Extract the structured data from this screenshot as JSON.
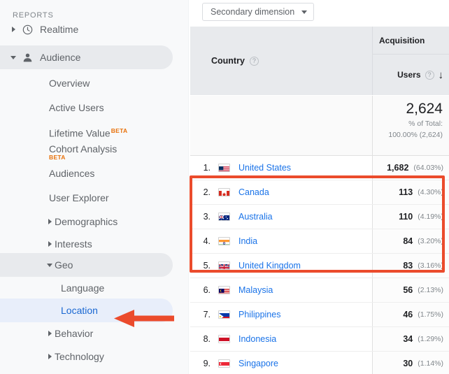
{
  "sidebar": {
    "section_label": "REPORTS",
    "items": [
      {
        "label": "Realtime",
        "level": 1,
        "caret": "right",
        "icon": "clock-icon",
        "state": "default"
      },
      {
        "label": "Audience",
        "level": 1,
        "caret": "down",
        "icon": "person-icon",
        "state": "selected-gray"
      },
      {
        "label": "Overview",
        "level": 2,
        "caret": "none",
        "state": "default"
      },
      {
        "label": "Active Users",
        "level": 2,
        "caret": "none",
        "state": "default"
      },
      {
        "label": "Lifetime Value",
        "level": 2,
        "caret": "none",
        "badge": "BETA",
        "badge_pos": "sup",
        "state": "default"
      },
      {
        "label": "Cohort Analysis",
        "level": 2,
        "caret": "none",
        "badge": "BETA",
        "badge_pos": "below",
        "state": "default"
      },
      {
        "label": "Audiences",
        "level": 2,
        "caret": "none",
        "state": "default"
      },
      {
        "label": "User Explorer",
        "level": 2,
        "caret": "none",
        "state": "default"
      },
      {
        "label": "Demographics",
        "level": 2,
        "caret": "right",
        "state": "default"
      },
      {
        "label": "Interests",
        "level": 2,
        "caret": "right",
        "state": "default"
      },
      {
        "label": "Geo",
        "level": 2,
        "caret": "down",
        "state": "selected-gray"
      },
      {
        "label": "Language",
        "level": 3,
        "caret": "none",
        "state": "default"
      },
      {
        "label": "Location",
        "level": 3,
        "caret": "none",
        "state": "active-blue"
      },
      {
        "label": "Behavior",
        "level": 2,
        "caret": "right",
        "state": "default"
      },
      {
        "label": "Technology",
        "level": 2,
        "caret": "right",
        "state": "default"
      }
    ]
  },
  "toolbar": {
    "secondary_dimension_label": "Secondary dimension"
  },
  "table": {
    "dimension_header": "Country",
    "dimension_help": "?",
    "metric_group_header": "Acquisition",
    "metric_header": "Users",
    "metric_help": "?",
    "sort_indicator": "↓",
    "total": {
      "value": "2,624",
      "of_total_label": "% of Total:",
      "of_total_value": "100.00% (2,624)"
    },
    "rows": [
      {
        "rank": "1.",
        "country": "United States",
        "flag": "us-flag",
        "users": "1,682",
        "percent": "(64.03%)"
      },
      {
        "rank": "2.",
        "country": "Canada",
        "flag": "ca-flag",
        "users": "113",
        "percent": "(4.30%)"
      },
      {
        "rank": "3.",
        "country": "Australia",
        "flag": "au-flag",
        "users": "110",
        "percent": "(4.19%)"
      },
      {
        "rank": "4.",
        "country": "India",
        "flag": "in-flag",
        "users": "84",
        "percent": "(3.20%)"
      },
      {
        "rank": "5.",
        "country": "United Kingdom",
        "flag": "gb-flag",
        "users": "83",
        "percent": "(3.16%)"
      },
      {
        "rank": "6.",
        "country": "Malaysia",
        "flag": "my-flag",
        "users": "56",
        "percent": "(2.13%)"
      },
      {
        "rank": "7.",
        "country": "Philippines",
        "flag": "ph-flag",
        "users": "46",
        "percent": "(1.75%)"
      },
      {
        "rank": "8.",
        "country": "Indonesia",
        "flag": "id-flag",
        "users": "34",
        "percent": "(1.29%)"
      },
      {
        "rank": "9.",
        "country": "Singapore",
        "flag": "sg-flag",
        "users": "30",
        "percent": "(1.14%)"
      }
    ]
  },
  "annotations": {
    "highlight_color": "#eb4b2c",
    "box_target": "rows 2-5",
    "arrow_target": "Location"
  },
  "colors": {
    "link": "#1a73e8",
    "sidebar_bg": "#f8f9fa",
    "header_bg": "#e8eaed",
    "beta": "#e8710a",
    "accent_red": "#eb4b2c"
  }
}
